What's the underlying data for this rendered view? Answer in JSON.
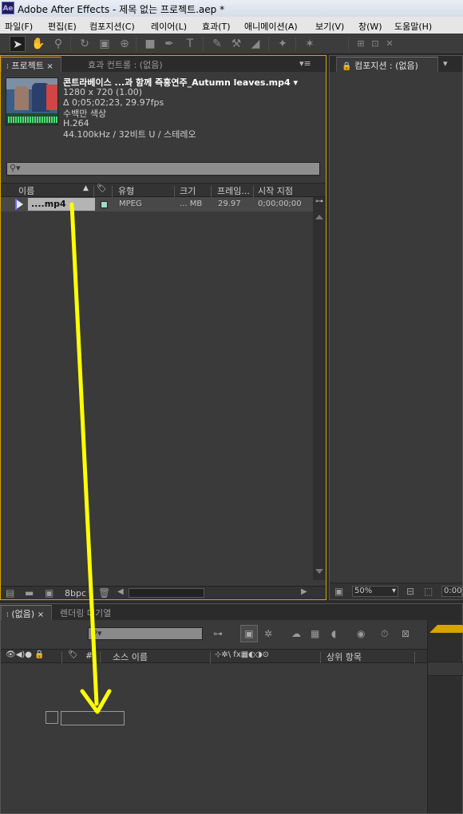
{
  "window": {
    "app_logo": "Ae",
    "title": "Adobe After Effects - 제목 없는 프로젝트.aep *"
  },
  "menu": [
    "파일(F)",
    "편집(E)",
    "컴포지션(C)",
    "레이어(L)",
    "효과(T)",
    "애니메이션(A)",
    "보기(V)",
    "창(W)",
    "도움말(H)"
  ],
  "toolbar": {
    "tools": [
      "selection-tool-icon",
      "hand-tool-icon",
      "zoom-tool-icon",
      "rotate-tool-icon",
      "camera-tool-icon",
      "pan-behind-tool-icon",
      "rectangle-tool-icon",
      "pen-tool-icon",
      "type-tool-icon",
      "brush-tool-icon",
      "eraser-tool-icon",
      "roto-brush-tool-icon",
      "puppet-tool-icon"
    ]
  },
  "project_panel": {
    "tab_label": "프로젝트",
    "tab_close": "×",
    "effects_tab_label": "효과 컨트롤 : (없음)",
    "menu_icon": "▾≡",
    "footage": {
      "name": "콘트라베이스 ...과 함께 즉흥연주_Autumn leaves.mp4 ▾",
      "resolution": "1280 x 720 (1.00)",
      "duration": "Δ 0;05;02;23, 29.97fps",
      "color": "수백만 색상",
      "codec": "H.264",
      "audio": "44.100kHz / 32비트 U / 스테레오"
    },
    "search_icon": "⚲▾",
    "columns": {
      "name": "이름",
      "label": "🏷",
      "type": "유형",
      "size": "크기",
      "fps": "프레임...",
      "in_point": "시작 지점"
    },
    "items": [
      {
        "name": "....mp4",
        "type": "MPEG",
        "size": "... MB",
        "fps": "29.97",
        "in_point": "0;00;00;00",
        "label_color": "#9fd9c7"
      }
    ],
    "footer": {
      "bpc": "8bpc"
    }
  },
  "comp_panel": {
    "tab_label": "컴포지션 : (없음)",
    "zoom": "50%",
    "timecode": "0:00"
  },
  "timeline_panel": {
    "tab_label": "(없음)",
    "tab_close": "×",
    "render_tab_label": "렌더링 대기열",
    "columns": {
      "switches": "👁◀)● 🔒",
      "hash": "#",
      "source_name": "소스 이름",
      "layer_switches": "⊹✲\\ fx▦◐◑⊙",
      "parent": "상위 항목"
    }
  },
  "colors": {
    "accent": "#d8a400",
    "panel_bg": "#3a3a3a",
    "annotation_arrow": "#ffff00"
  }
}
